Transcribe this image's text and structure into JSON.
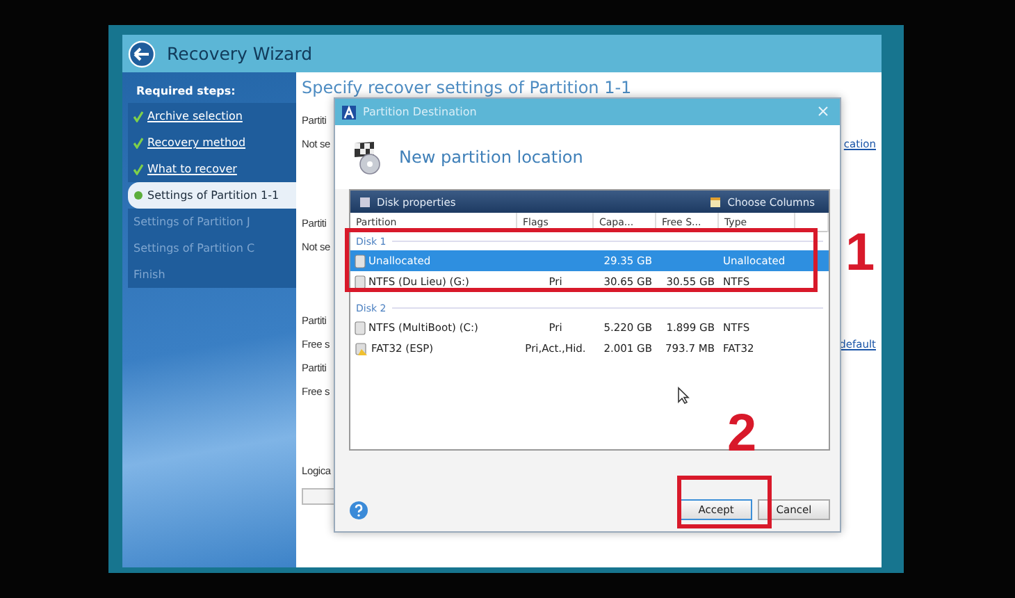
{
  "wizard": {
    "title": "Recovery Wizard",
    "sidebar": {
      "heading": "Required steps:",
      "steps": [
        {
          "label": "Archive selection",
          "completed": true,
          "selected": false
        },
        {
          "label": "Recovery method",
          "completed": true,
          "selected": false
        },
        {
          "label": "What to recover",
          "completed": true,
          "selected": false
        },
        {
          "label": "Settings of Partition 1-1",
          "completed": false,
          "selected": true
        },
        {
          "label": "Settings of Partition J",
          "completed": false,
          "selected": false
        },
        {
          "label": "Settings of Partition C",
          "completed": false,
          "selected": false
        },
        {
          "label": "Finish",
          "completed": false,
          "selected": false
        }
      ]
    },
    "content": {
      "heading": "Specify recover settings of Partition 1-1",
      "sections": [
        {
          "lines": [
            {
              "text": "Partiti"
            },
            {
              "text": "Not se",
              "link": "cation"
            }
          ]
        },
        {
          "lines": [
            {
              "text": "Partiti"
            },
            {
              "text": "Not se"
            }
          ]
        },
        {
          "lines": [
            {
              "text": "Partiti"
            },
            {
              "text": "Free s",
              "link": "default"
            },
            {
              "text": "Partiti"
            },
            {
              "text": "Free s"
            }
          ]
        },
        {
          "lines": [
            {
              "text": "Logica"
            }
          ]
        }
      ]
    }
  },
  "dialog": {
    "title": "Partition Destination",
    "heading": "New partition location",
    "toolbar": {
      "left": "Disk properties",
      "right": "Choose Columns"
    },
    "columns": [
      "Partition",
      "Flags",
      "Capa...",
      "Free S...",
      "Type"
    ],
    "groups": [
      {
        "label": "Disk 1",
        "rows": [
          {
            "kind": "disk",
            "selected": true,
            "cells": [
              "Unallocated",
              "",
              "29.35 GB",
              "",
              "Unallocated"
            ]
          },
          {
            "kind": "disk",
            "selected": false,
            "cells": [
              "NTFS (Du Lieu) (G:)",
              "Pri",
              "30.65 GB",
              "30.55 GB",
              "NTFS"
            ]
          }
        ]
      },
      {
        "label": "Disk 2",
        "rows": [
          {
            "kind": "disk",
            "selected": false,
            "cells": [
              "NTFS (MultiBoot) (C:)",
              "Pri",
              "5.220 GB",
              "1.899 GB",
              "NTFS"
            ]
          },
          {
            "kind": "efi",
            "selected": false,
            "cells": [
              "FAT32 (ESP)",
              "Pri,Act.,Hid.",
              "2.001 GB",
              "793.7 MB",
              "FAT32"
            ]
          }
        ]
      }
    ],
    "buttons": [
      {
        "label": "Accept",
        "focused": true
      },
      {
        "label": "Cancel",
        "focused": false
      }
    ]
  },
  "callouts": [
    {
      "label": "1"
    },
    {
      "label": "2"
    }
  ]
}
